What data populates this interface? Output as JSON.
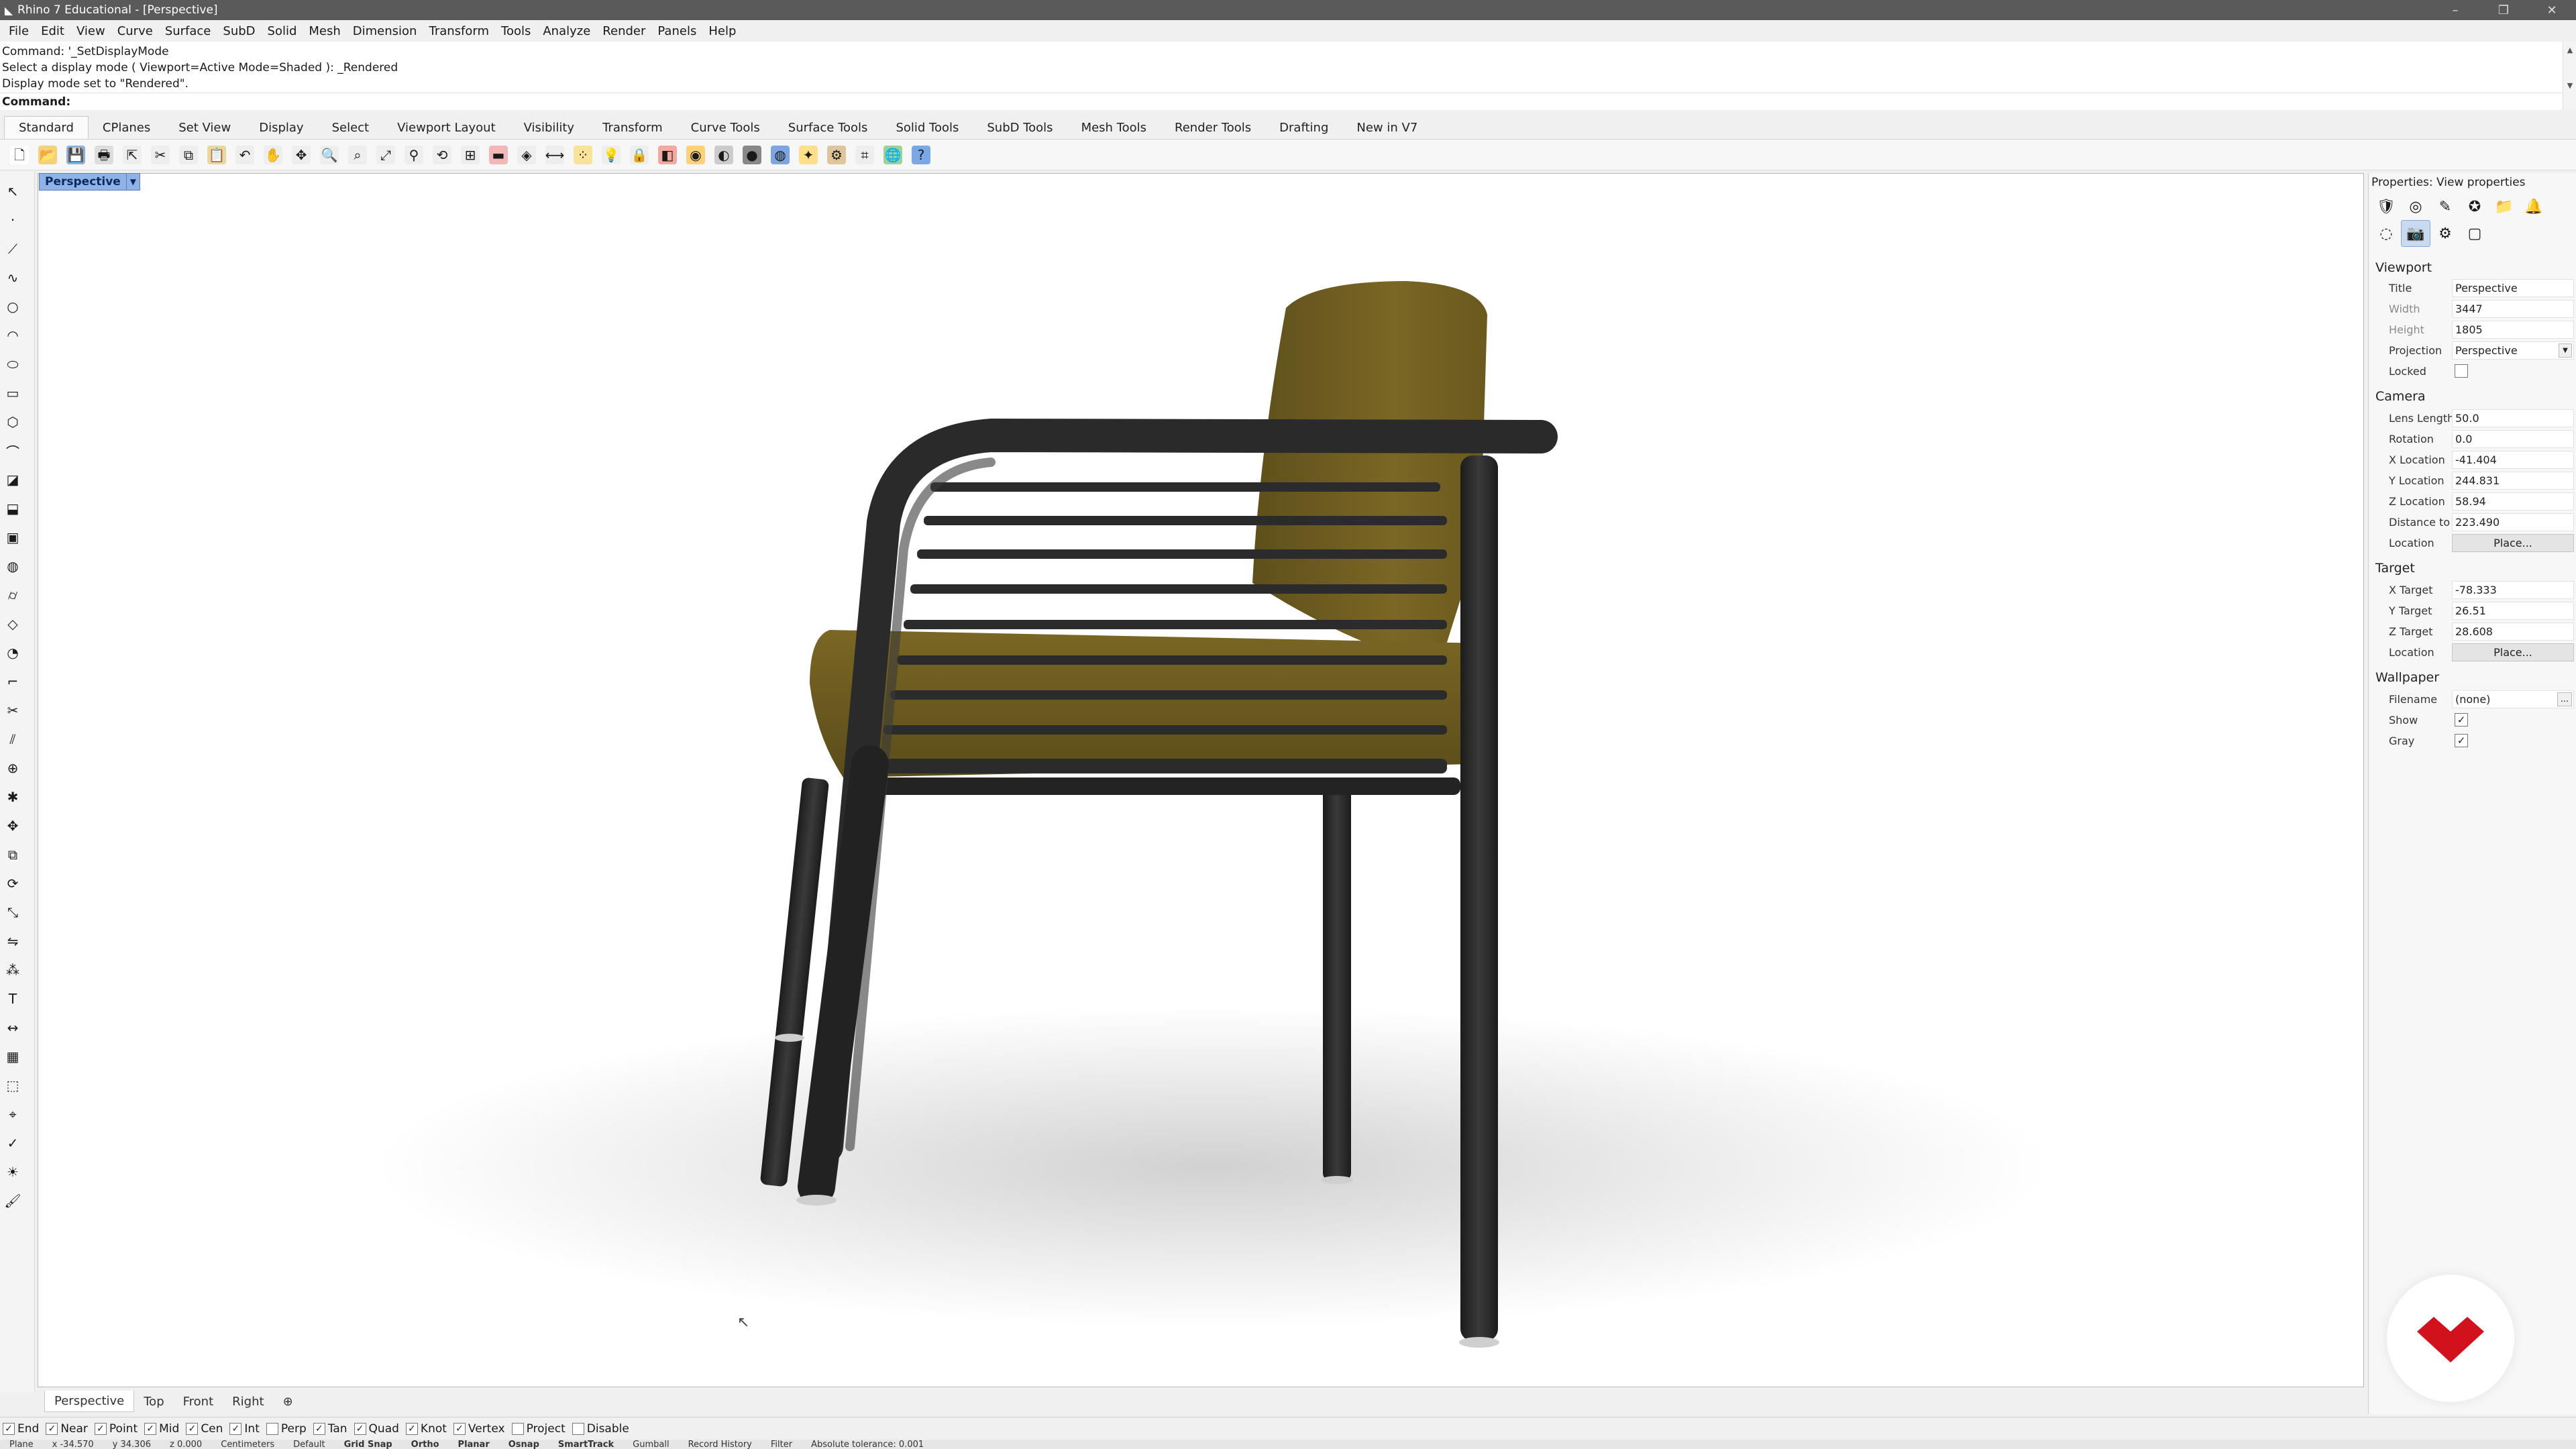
{
  "window": {
    "title": "Rhino 7 Educational - [Perspective]",
    "controls": {
      "minimize": "–",
      "restore": "❐",
      "close": "✕"
    }
  },
  "menu": [
    "File",
    "Edit",
    "View",
    "Curve",
    "Surface",
    "SubD",
    "Solid",
    "Mesh",
    "Dimension",
    "Transform",
    "Tools",
    "Analyze",
    "Render",
    "Panels",
    "Help"
  ],
  "command": {
    "history": [
      "Command: '_SetDisplayMode",
      "Select a display mode ( Viewport=Active  Mode=Shaded ): _Rendered",
      "Display mode set to \"Rendered\"."
    ],
    "prompt_label": "Command:",
    "prompt_value": ""
  },
  "toolbar_tabs": {
    "active": "Standard",
    "items": [
      "Standard",
      "CPlanes",
      "Set View",
      "Display",
      "Select",
      "Viewport Layout",
      "Visibility",
      "Transform",
      "Curve Tools",
      "Surface Tools",
      "Solid Tools",
      "SubD Tools",
      "Mesh Tools",
      "Render Tools",
      "Drafting",
      "New in V7"
    ]
  },
  "toolbar_icons": [
    {
      "name": "new-icon",
      "glyph": "🗋",
      "color": "#ffffff"
    },
    {
      "name": "open-icon",
      "glyph": "📂",
      "color": "#f3d27a"
    },
    {
      "name": "save-icon",
      "glyph": "💾",
      "color": "#8fb0d8"
    },
    {
      "name": "print-icon",
      "glyph": "🖶",
      "color": "#dddddd"
    },
    {
      "name": "export-icon",
      "glyph": "⇱",
      "color": "#eeeeee"
    },
    {
      "name": "cut-icon",
      "glyph": "✂",
      "color": "#eeeeee"
    },
    {
      "name": "copy-icon",
      "glyph": "⧉",
      "color": "#eeeeee"
    },
    {
      "name": "paste-icon",
      "glyph": "📋",
      "color": "#e8d8a0"
    },
    {
      "name": "undo-icon",
      "glyph": "↶",
      "color": "#eeeeee"
    },
    {
      "name": "pan-icon",
      "glyph": "✋",
      "color": "#eeeeee"
    },
    {
      "name": "rotate-view-icon",
      "glyph": "✥",
      "color": "#eeeeee"
    },
    {
      "name": "zoom-icon",
      "glyph": "🔍",
      "color": "#eeeeee"
    },
    {
      "name": "zoom-window-icon",
      "glyph": "⌕",
      "color": "#eeeeee"
    },
    {
      "name": "zoom-extents-icon",
      "glyph": "⤢",
      "color": "#eeeeee"
    },
    {
      "name": "zoom-selected-icon",
      "glyph": "⚲",
      "color": "#eeeeee"
    },
    {
      "name": "undo-view-icon",
      "glyph": "⟲",
      "color": "#eeeeee"
    },
    {
      "name": "four-viewports-icon",
      "glyph": "⊞",
      "color": "#eeeeee"
    },
    {
      "name": "cplane-icon",
      "glyph": "▬",
      "color": "#f2b8b8"
    },
    {
      "name": "named-view-icon",
      "glyph": "◈",
      "color": "#eeeeee"
    },
    {
      "name": "named-cplane-icon",
      "glyph": "⟷",
      "color": "#eeeeee"
    },
    {
      "name": "select-points-icon",
      "glyph": "⁘",
      "color": "#f7e39a"
    },
    {
      "name": "light-icon",
      "glyph": "💡",
      "color": "#eeeeee"
    },
    {
      "name": "lock-icon",
      "glyph": "🔒",
      "color": "#eeeeee"
    },
    {
      "name": "layer-icon",
      "glyph": "◧",
      "color": "#f3a9a0"
    },
    {
      "name": "color-wheel-icon",
      "glyph": "◉",
      "color": "#ffd27a"
    },
    {
      "name": "shaded-icon",
      "glyph": "◐",
      "color": "#cccccc"
    },
    {
      "name": "rendered-icon",
      "glyph": "●",
      "color": "#888888"
    },
    {
      "name": "render-icon",
      "glyph": "◍",
      "color": "#7da6e0"
    },
    {
      "name": "highlight-icon",
      "glyph": "✦",
      "color": "#ffe08a"
    },
    {
      "name": "options-icon",
      "glyph": "⚙",
      "color": "#e0c49a"
    },
    {
      "name": "grid-snap-icon",
      "glyph": "⌗",
      "color": "#eeeeee"
    },
    {
      "name": "globe-icon",
      "glyph": "🌐",
      "color": "#9dd19a"
    },
    {
      "name": "help-icon",
      "glyph": "?",
      "color": "#7aa7e6"
    }
  ],
  "left_tools": [
    {
      "name": "select-arrow-icon",
      "glyph": "↖"
    },
    {
      "name": "point-icon",
      "glyph": "·"
    },
    {
      "name": "polyline-icon",
      "glyph": "⟋"
    },
    {
      "name": "curve-icon",
      "glyph": "∿"
    },
    {
      "name": "circle-icon",
      "glyph": "○"
    },
    {
      "name": "arc-icon",
      "glyph": "◠"
    },
    {
      "name": "ellipse-icon",
      "glyph": "⬭"
    },
    {
      "name": "rectangle-icon",
      "glyph": "▭"
    },
    {
      "name": "polygon-icon",
      "glyph": "⬡"
    },
    {
      "name": "freeform-icon",
      "glyph": "⌒"
    },
    {
      "name": "surface-icon",
      "glyph": "◪"
    },
    {
      "name": "extrude-icon",
      "glyph": "⬓"
    },
    {
      "name": "box-icon",
      "glyph": "▣"
    },
    {
      "name": "sphere-icon",
      "glyph": "◍"
    },
    {
      "name": "cylinder-icon",
      "glyph": "⌭"
    },
    {
      "name": "mesh-icon",
      "glyph": "◇"
    },
    {
      "name": "boolean-icon",
      "glyph": "◔"
    },
    {
      "name": "fillet-icon",
      "glyph": "⌐"
    },
    {
      "name": "trim-icon",
      "glyph": "✂"
    },
    {
      "name": "split-icon",
      "glyph": "⫽"
    },
    {
      "name": "join-icon",
      "glyph": "⊕"
    },
    {
      "name": "explode-icon",
      "glyph": "✱"
    },
    {
      "name": "move-icon",
      "glyph": "✥"
    },
    {
      "name": "copy-tool-icon",
      "glyph": "⧉"
    },
    {
      "name": "rotate-icon",
      "glyph": "⟳"
    },
    {
      "name": "scale-icon",
      "glyph": "⤡"
    },
    {
      "name": "mirror-icon",
      "glyph": "⇋"
    },
    {
      "name": "array-icon",
      "glyph": "⁂"
    },
    {
      "name": "text-icon",
      "glyph": "T"
    },
    {
      "name": "dimension-icon",
      "glyph": "↔"
    },
    {
      "name": "hatch-icon",
      "glyph": "▦"
    },
    {
      "name": "block-icon",
      "glyph": "⬚"
    },
    {
      "name": "analyze-icon",
      "glyph": "⌖"
    },
    {
      "name": "check-icon",
      "glyph": "✓"
    },
    {
      "name": "render-tool-icon",
      "glyph": "☀"
    },
    {
      "name": "paint-icon",
      "glyph": "🖌"
    }
  ],
  "viewport": {
    "label": "Perspective",
    "model_colors": {
      "frame": "#2b2b2b",
      "cushion": "#6b5a1f",
      "cushion_light": "#7f6c27"
    }
  },
  "viewport_tabs": {
    "active": "Perspective",
    "items": [
      "Perspective",
      "Top",
      "Front",
      "Right"
    ],
    "add": "⊕"
  },
  "osnaps": [
    {
      "label": "End",
      "checked": true
    },
    {
      "label": "Near",
      "checked": true
    },
    {
      "label": "Point",
      "checked": true
    },
    {
      "label": "Mid",
      "checked": true
    },
    {
      "label": "Cen",
      "checked": true
    },
    {
      "label": "Int",
      "checked": true
    },
    {
      "label": "Perp",
      "checked": false
    },
    {
      "label": "Tan",
      "checked": true
    },
    {
      "label": "Quad",
      "checked": true
    },
    {
      "label": "Knot",
      "checked": true
    },
    {
      "label": "Vertex",
      "checked": true
    },
    {
      "label": "Project",
      "checked": false
    },
    {
      "label": "Disable",
      "checked": false
    }
  ],
  "status": {
    "cplane": "Plane",
    "x": "x -34.570",
    "y": "y 34.306",
    "z": "z 0.000",
    "units": "Centimeters",
    "layer": "Default",
    "modes": [
      "Grid Snap",
      "Ortho",
      "Planar",
      "Osnap",
      "SmartTrack",
      "Gumball",
      "Record History",
      "Filter"
    ],
    "tolerance": "Absolute tolerance: 0.001"
  },
  "properties": {
    "title": "Properties: View properties",
    "icons": [
      {
        "name": "object-props-icon",
        "glyph": "🛡",
        "selected": false
      },
      {
        "name": "material-icon",
        "glyph": "◎",
        "selected": false
      },
      {
        "name": "edit-icon",
        "glyph": "✎",
        "selected": false
      },
      {
        "name": "environment-icon",
        "glyph": "✪",
        "selected": false
      },
      {
        "name": "folder-icon",
        "glyph": "📁",
        "selected": false
      },
      {
        "name": "notification-icon",
        "glyph": "🔔",
        "selected": false
      },
      {
        "name": "more-icon",
        "glyph": "◌",
        "selected": false
      },
      {
        "name": "camera-icon",
        "glyph": "📷",
        "selected": true
      },
      {
        "name": "display-icon",
        "glyph": "⚙",
        "selected": false
      },
      {
        "name": "frame-icon",
        "glyph": "▢",
        "selected": false
      }
    ],
    "sections": {
      "viewport": "Viewport",
      "camera": "Camera",
      "target": "Target",
      "wallpaper": "Wallpaper"
    },
    "viewport_rows": {
      "title_label": "Title",
      "title_value": "Perspective",
      "width_label": "Width",
      "width_value": "3447",
      "height_label": "Height",
      "height_value": "1805",
      "projection_label": "Projection",
      "projection_value": "Perspective",
      "locked_label": "Locked",
      "locked": false
    },
    "camera_rows": {
      "lens_label": "Lens Length(...",
      "lens_value": "50.0",
      "rotation_label": "Rotation",
      "rotation_value": "0.0",
      "xloc_label": "X Location",
      "xloc_value": "-41.404",
      "yloc_label": "Y Location",
      "yloc_value": "244.831",
      "zloc_label": "Z Location",
      "zloc_value": "58.94",
      "dist_label": "Distance to T...",
      "dist_value": "223.490",
      "location_label": "Location",
      "location_button": "Place..."
    },
    "target_rows": {
      "xt_label": "X Target",
      "xt_value": "-78.333",
      "yt_label": "Y Target",
      "yt_value": "26.51",
      "zt_label": "Z Target",
      "zt_value": "28.608",
      "location_label": "Location",
      "location_button": "Place..."
    },
    "wallpaper_rows": {
      "filename_label": "Filename",
      "filename_value": "(none)",
      "browse": "...",
      "show_label": "Show",
      "show": true,
      "gray_label": "Gray",
      "gray": true
    }
  },
  "badge_color": "#d1111b"
}
